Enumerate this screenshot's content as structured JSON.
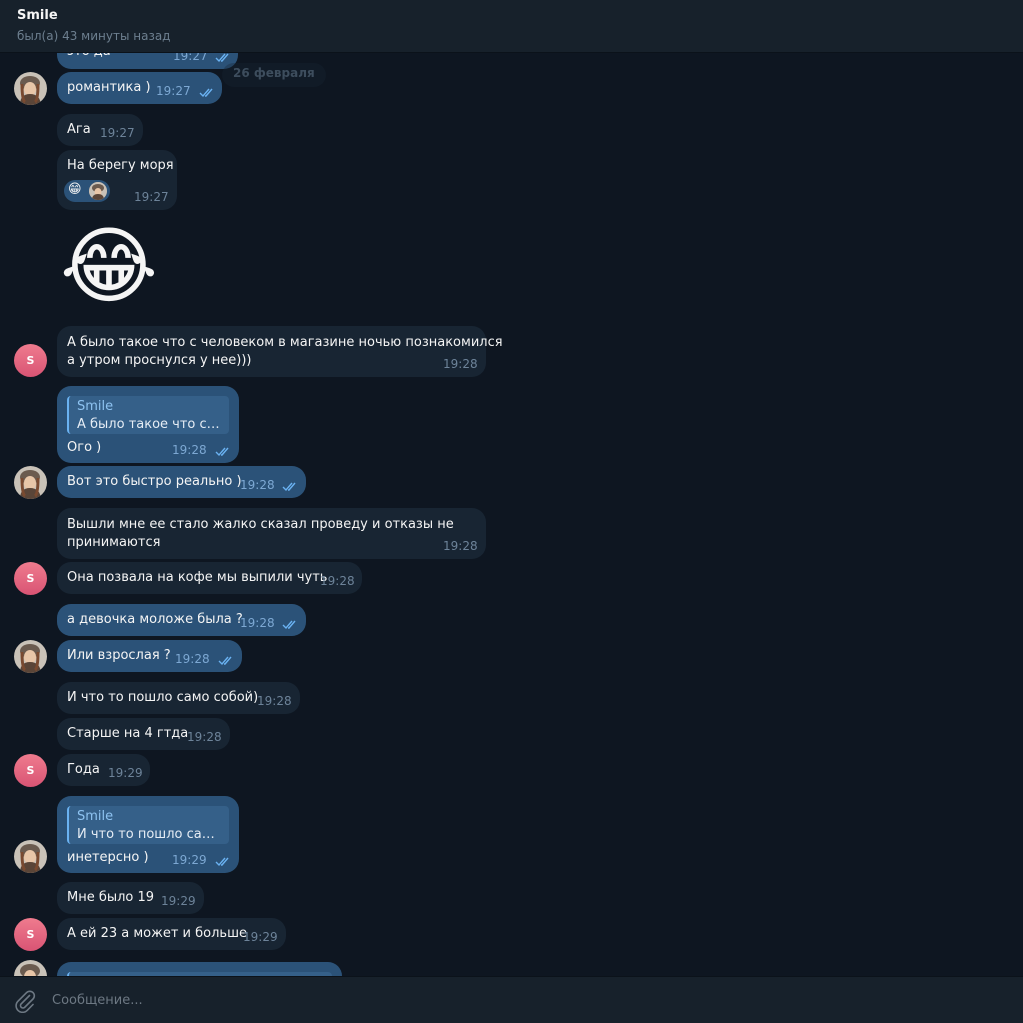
{
  "header": {
    "name": "Smile",
    "status": "был(а) 43 минуты назад"
  },
  "date_pill": "26 февраля",
  "avatar_letter": "S",
  "messages": [
    {
      "text": "это да",
      "time": "19:27"
    },
    {
      "text": "романтика )",
      "time": "19:27"
    },
    {
      "text": "Ага",
      "time": "19:27"
    },
    {
      "text": "На берегу моря",
      "time": "19:27"
    },
    {
      "sticker": "😂"
    },
    {
      "text": "А было такое что с человеком в магазине ночью познакомился",
      "text2": "а утром проснулся у нее)))",
      "time": "19:28"
    },
    {
      "reply_name": "Smile",
      "reply_text": "А было такое что с человеком в магазине ночью познакомился",
      "text": "Ого )",
      "time": "19:28"
    },
    {
      "text": "Вот это быстро реально )",
      "time": "19:28"
    },
    {
      "text": "Вышли мне ее стало жалко сказал проведу и отказы не",
      "text2": "принимаются",
      "time": "19:28"
    },
    {
      "text": "Она позвала на кофе мы выпили чуть",
      "time": "19:28"
    },
    {
      "text": "а девочка моложе была ?",
      "time": "19:28"
    },
    {
      "text": "Или взрослая ?",
      "time": "19:28"
    },
    {
      "text": "И что то пошло само собой)",
      "time": "19:28"
    },
    {
      "text": "Старше на 4 гтда",
      "time": "19:28"
    },
    {
      "text": "Года",
      "time": "19:29"
    },
    {
      "reply_name": "Smile",
      "reply_text": "И что то пошло само собой)",
      "text": "инетерсно )",
      "time": "19:29"
    },
    {
      "text": "Мне было 19",
      "time": "19:29"
    },
    {
      "text": "А ей 23 а может и больше",
      "time": "19:29"
    }
  ],
  "reactions": [
    "😁"
  ],
  "composer": {
    "placeholder": "Сообщение..."
  },
  "colors": {
    "background": "#0e1621",
    "incoming_bubble": "#182533",
    "outgoing_bubble": "#2b5278",
    "accent": "#6ab2f2"
  },
  "icons": [
    "paperclip-icon",
    "double-check-icon"
  ]
}
